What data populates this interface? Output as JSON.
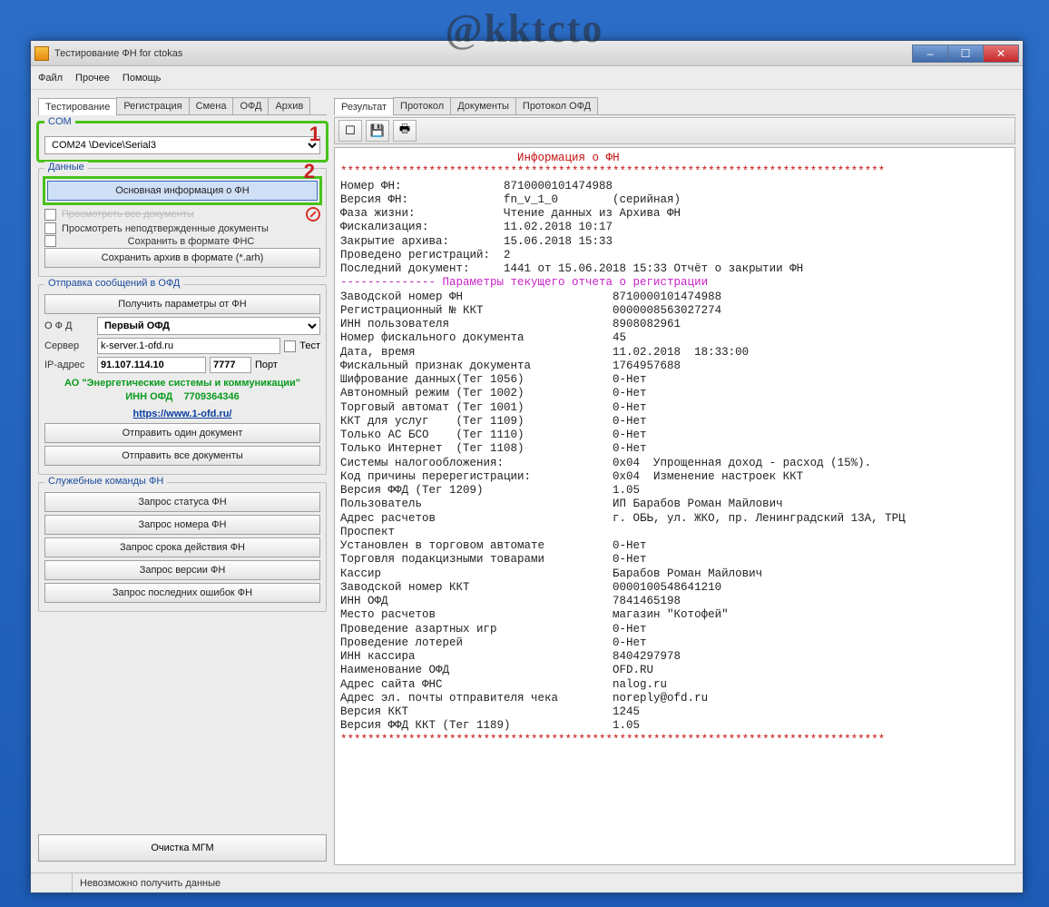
{
  "watermark": "@kktcto",
  "window": {
    "title": "Тестирование ФН for ctokas",
    "minimize": "–",
    "maximize": "☐",
    "close": "✕"
  },
  "menubar": [
    "Файл",
    "Прочее",
    "Помощь"
  ],
  "left_tabs": [
    "Тестирование",
    "Регистрация",
    "Смена",
    "ОФД",
    "Архив"
  ],
  "right_tabs": [
    "Результат",
    "Протокол",
    "Документы",
    "Протокол ОФД"
  ],
  "groups": {
    "com": {
      "label": "COM",
      "marker": "1",
      "value": "COM24 \\Device\\Serial3"
    },
    "data": {
      "label": "Данные",
      "marker": "2",
      "btn_main_info": "Основная информация о ФН",
      "chk_view_all": "Просмотреть все документы",
      "chk_view_unconf": "Просмотреть неподтвержденные документы",
      "chk_save_fns": "Сохранить в формате ФНС",
      "btn_save_arh": "Сохранить архив в формате (*.arh)"
    },
    "ofd": {
      "label": "Отправка сообщений в ОФД",
      "btn_get_params": "Получить параметры от ФН",
      "ofd_label": "О Ф Д",
      "ofd_select": "Первый ОФД",
      "server_label": "Сервер",
      "server_value": "k-server.1-ofd.ru",
      "test_label": "Тест",
      "ip_label": "IP-адрес",
      "ip_value": "91.107.114.10",
      "port_value": "7777",
      "port_label": "Порт",
      "org": "АО \"Энергетические системы и коммуникации\"",
      "inn_label": "ИНН ОФД",
      "inn_value": "7709364346",
      "link": "https://www.1-ofd.ru/",
      "btn_send_one": "Отправить один документ",
      "btn_send_all": "Отправить все документы"
    },
    "service": {
      "label": "Служебные команды ФН",
      "buttons": [
        "Запрос статуса ФН",
        "Запрос номера ФН",
        "Запрос срока действия ФН",
        "Запрос версии ФН",
        "Запрос последних ошибок ФН"
      ]
    }
  },
  "clear_btn": "Очистка МГМ",
  "statusbar": "Невозможно получить данные",
  "toolbar_icons": {
    "new": "☐",
    "save": "💾",
    "print": "🖶"
  },
  "console": {
    "header_title": "Информация о ФН",
    "stars": "********************************************************************************",
    "params_header": "-------------- Параметры текущего отчета о регистрации",
    "lines_top": [
      "Номер ФН:               8710000101474988",
      "Версия ФН:              fn_v_1_0        (серийная)",
      "Фаза жизни:             Чтение данных из Архива ФН",
      "Фискализация:           11.02.2018 10:17",
      "Закрытие архива:        15.06.2018 15:33",
      "Проведено регистраций:  2",
      "Последний документ:     1441 от 15.06.2018 15:33 Отчёт о закрытии ФН"
    ],
    "lines_params": [
      "Заводской номер ФН                      8710000101474988",
      "Регистрационный № ККТ                   0000008563027274",
      "ИНН пользователя                        8908082961",
      "Номер фискального документа             45",
      "Дата, время                             11.02.2018  18:33:00",
      "Фискальный признак документа            1764957688",
      "Шифрование данных(Тег 1056)             0-Нет",
      "Автономный режим (Тег 1002)             0-Нет",
      "Торговый автомат (Тег 1001)             0-Нет",
      "ККТ для услуг    (Тег 1109)             0-Нет",
      "Только АС БСО    (Тег 1110)             0-Нет",
      "Только Интернет  (Тег 1108)             0-Нет",
      "Системы налогообложения:                0x04  Упрощенная доход - расход (15%).",
      "Код причины перерегистрации:            0x04  Изменение настроек ККТ",
      "Версия ФФД (Тег 1209)                   1.05",
      "Пользователь                            ИП Барабов Роман Майлович",
      "Адрес расчетов                          г. ОБЬ, ул. ЖКО, пр. Ленинградский 13А, ТРЦ",
      "Проспект",
      "Установлен в торговом автомате          0-Нет",
      "Торговля подакцизными товарами          0-Нет",
      "Кассир                                  Барабов Роман Майлович",
      "Заводской номер ККТ                     0000100548641210",
      "ИНН ОФД                                 7841465198",
      "Место расчетов                          магазин \"Котофей\"",
      "Проведение азартных игр                 0-Нет",
      "Проведение лотерей                      0-Нет",
      "ИНН кассира                             8404297978",
      "Наименование ОФД                        OFD.RU",
      "Адрес сайта ФНС                         nalog.ru",
      "Адрес эл. почты отправителя чека        noreply@ofd.ru",
      "Версия ККТ                              1245",
      "Версия ФФД ККТ (Тег 1189)               1.05"
    ]
  }
}
